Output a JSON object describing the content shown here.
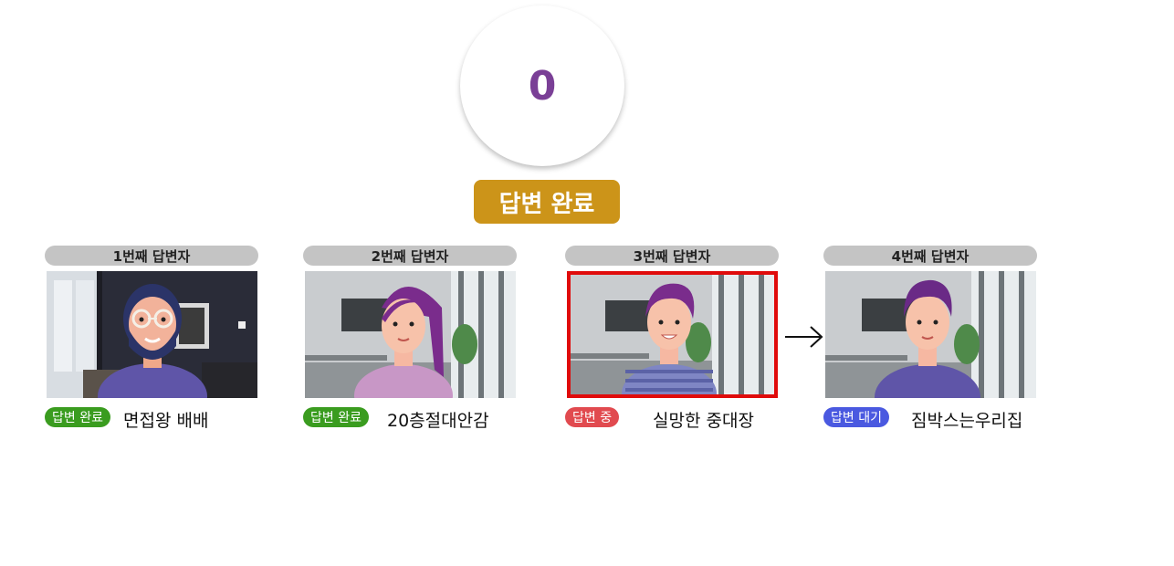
{
  "timer": {
    "value": "0"
  },
  "status_banner": {
    "label": "답변 완료"
  },
  "colors": {
    "timer_text": "#7a3f96",
    "banner": "#cc9419",
    "badge_done": "#3a9c1f",
    "badge_active": "#e14a4f",
    "badge_waiting": "#4a59e0",
    "active_frame": "#e00b0b"
  },
  "participants": [
    {
      "header": "1번째 답변자",
      "badge": "답변 완료",
      "name": "면접왕 배배",
      "state": "done"
    },
    {
      "header": "2번째 답변자",
      "badge": "답변 완료",
      "name": "20층절대안감",
      "state": "done"
    },
    {
      "header": "3번째 답변자",
      "badge": "답변 중",
      "name": "실망한 중대장",
      "state": "active"
    },
    {
      "header": "4번째 답변자",
      "badge": "답변 대기",
      "name": "짐박스는우리집",
      "state": "waiting"
    }
  ],
  "icons": {
    "next_arrow": "right-arrow-icon"
  }
}
